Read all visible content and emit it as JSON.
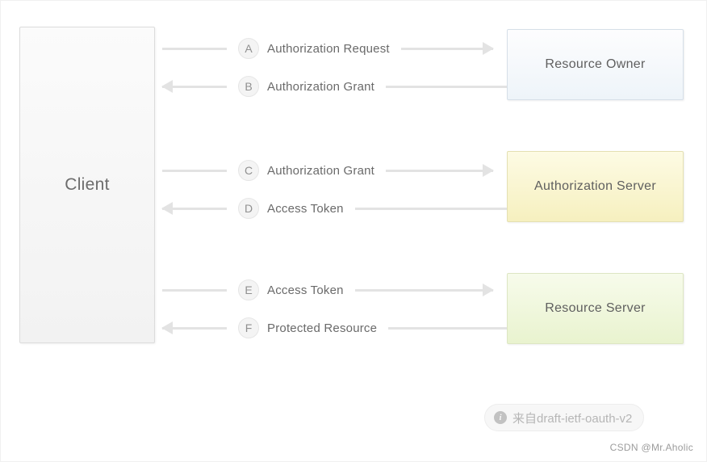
{
  "diagram": {
    "client": {
      "label": "Client"
    },
    "nodes": [
      {
        "id": "resource-owner",
        "label": "Resource Owner",
        "color": "#eef4f9"
      },
      {
        "id": "authorization-server",
        "label": "Authorization Server",
        "color": "#f6f0bf"
      },
      {
        "id": "resource-server",
        "label": "Resource Server",
        "color": "#e9f3cf"
      }
    ],
    "steps": [
      {
        "badge": "A",
        "label": "Authorization Request",
        "direction": "right"
      },
      {
        "badge": "B",
        "label": "Authorization Grant",
        "direction": "left"
      },
      {
        "badge": "C",
        "label": "Authorization Grant",
        "direction": "right"
      },
      {
        "badge": "D",
        "label": "Access Token",
        "direction": "left"
      },
      {
        "badge": "E",
        "label": "Access Token",
        "direction": "right"
      },
      {
        "badge": "F",
        "label": "Protected Resource",
        "direction": "left"
      }
    ],
    "source_badge": {
      "icon": "info-icon",
      "text": "来自draft-ietf-oauth-v2"
    },
    "watermark": "CSDN @Mr.Aholic"
  }
}
